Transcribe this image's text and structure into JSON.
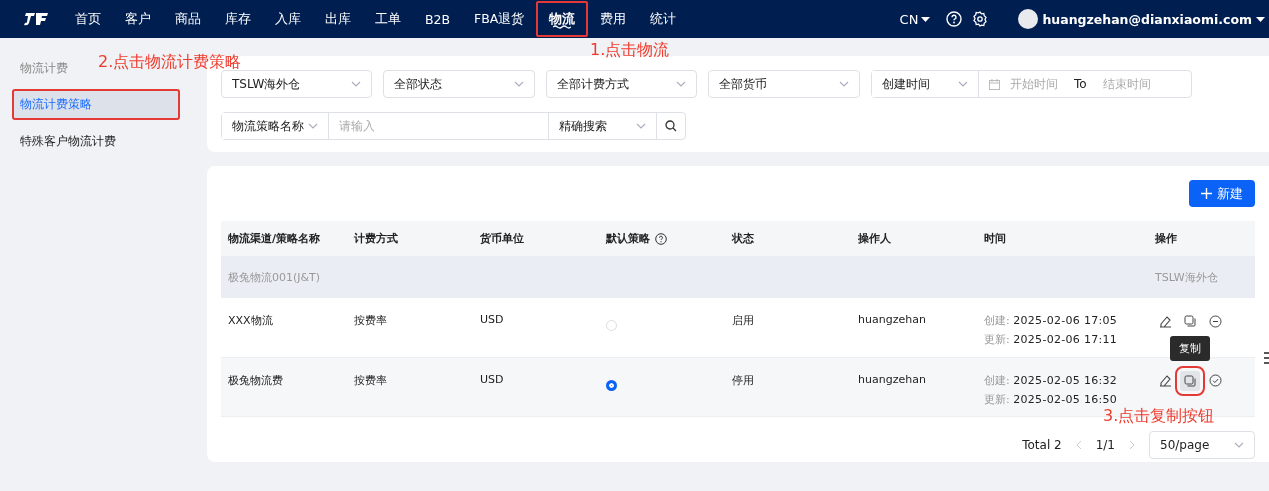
{
  "nav": {
    "items": [
      {
        "label": "首页",
        "selected": false
      },
      {
        "label": "客户",
        "selected": false
      },
      {
        "label": "商品",
        "selected": false
      },
      {
        "label": "库存",
        "selected": false
      },
      {
        "label": "入库",
        "selected": false
      },
      {
        "label": "出库",
        "selected": false
      },
      {
        "label": "工单",
        "selected": false
      },
      {
        "label": "B2B",
        "selected": false
      },
      {
        "label": "FBA退货",
        "selected": false
      },
      {
        "label": "物流",
        "selected": true,
        "callout": "1.点击物流"
      },
      {
        "label": "费用",
        "selected": false
      },
      {
        "label": "统计",
        "selected": false
      }
    ],
    "language": "CN",
    "user": "huangzehan@dianxiaomi.com"
  },
  "sidebar": {
    "group": "物流计费",
    "items": [
      {
        "label": "物流计费策略",
        "selected": true,
        "callout": "2.点击物流计费策略"
      },
      {
        "label": "特殊客户物流计费",
        "selected": false
      }
    ]
  },
  "filters": {
    "warehouse": "TSLW海外仓",
    "status": "全部状态",
    "billing": "全部计费方式",
    "currency": "全部货币",
    "time_type": "创建时间",
    "start_placeholder": "开始时间",
    "to": "To",
    "end_placeholder": "结束时间",
    "search_field": "物流策略名称",
    "search_placeholder": "请输入",
    "match": "精确搜索"
  },
  "new_button": "新建",
  "table": {
    "columns": [
      "物流渠道/策略名称",
      "计费方式",
      "货币单位",
      "默认策略",
      "状态",
      "操作人",
      "时间",
      "操作"
    ],
    "group": {
      "name": "极兔物流001(J&T)",
      "warehouse": "TSLW海外仓"
    },
    "rows": [
      {
        "name": "XXX物流",
        "billing": "按费率",
        "currency": "USD",
        "default": false,
        "status": "启用",
        "operator": "huangzehan",
        "created_label": "创建:",
        "created": "2025-02-06 17:05",
        "updated_label": "更新:",
        "updated": "2025-02-06 17:11",
        "actions": [
          {
            "kind": "edit"
          },
          {
            "kind": "copy"
          },
          {
            "kind": "disable"
          }
        ]
      },
      {
        "name": "极兔物流费",
        "billing": "按费率",
        "currency": "USD",
        "default": true,
        "status": "停用",
        "operator": "huangzehan",
        "created_label": "创建:",
        "created": "2025-02-05 16:32",
        "updated_label": "更新:",
        "updated": "2025-02-05 16:50",
        "actions": [
          {
            "kind": "edit"
          },
          {
            "kind": "copy",
            "tooltip": "复制",
            "callout": "3.点击复制按钮"
          },
          {
            "kind": "enable"
          }
        ]
      }
    ]
  },
  "pagination": {
    "total": "Total 2",
    "page": "1/1",
    "page_size": "50/page"
  }
}
